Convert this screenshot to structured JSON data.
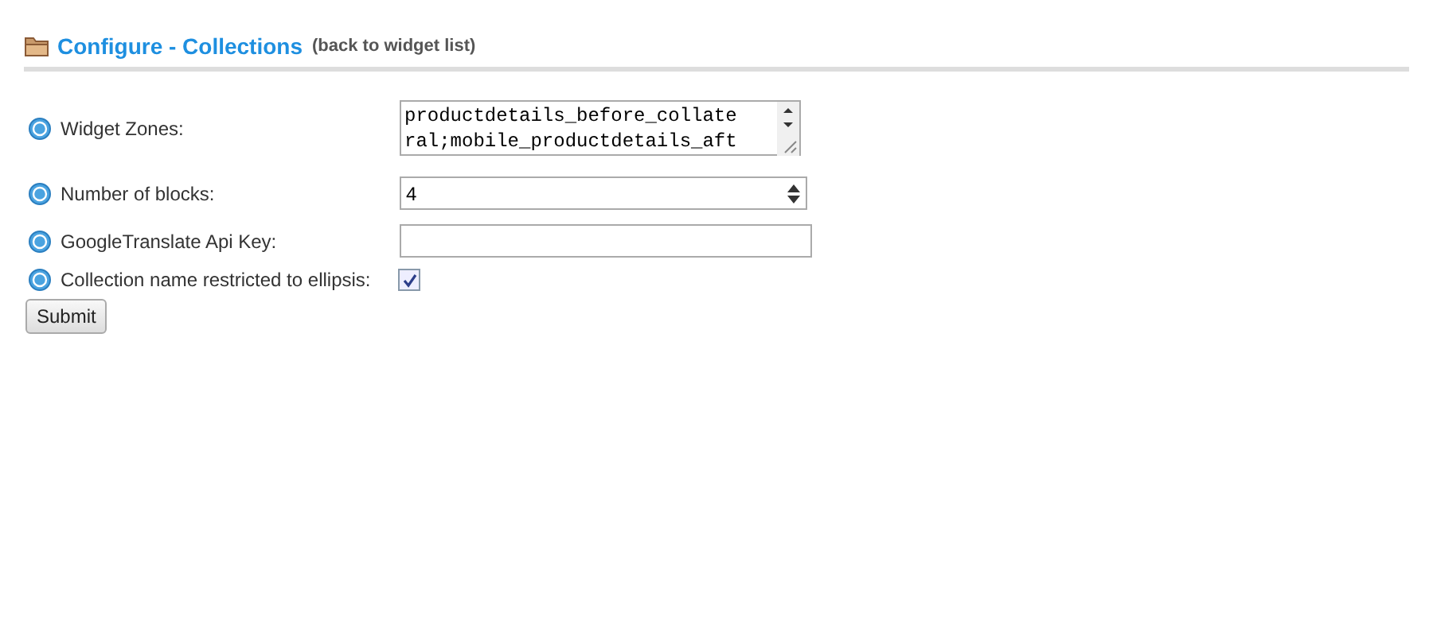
{
  "header": {
    "title": "Configure - Collections",
    "back_link": "(back to widget list)"
  },
  "fields": [
    {
      "kind": "textarea",
      "label": "Widget Zones:",
      "lines": [
        "productdetails_before_collate",
        "ral;mobile_productdetails_aft"
      ]
    },
    {
      "kind": "number",
      "label": "Number of blocks:",
      "value": "4"
    },
    {
      "kind": "text",
      "label": "GoogleTranslate Api Key:"
    },
    {
      "kind": "checkbox",
      "label": "Collection name restricted to ellipsis:",
      "checked": true
    }
  ],
  "submit": "Submit"
}
